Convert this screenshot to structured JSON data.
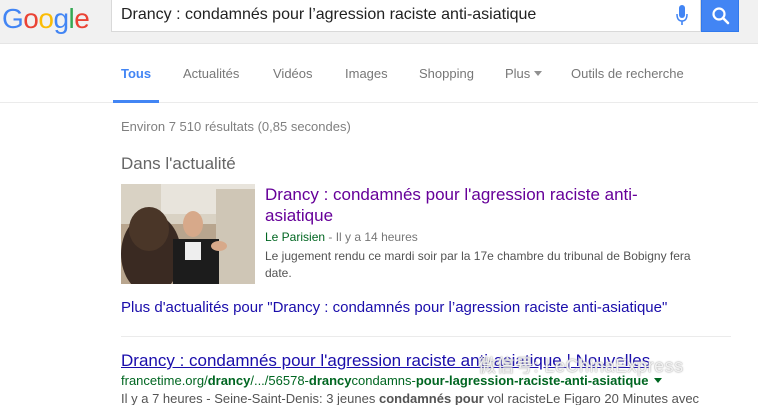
{
  "logo": {
    "letters": [
      {
        "char": "G",
        "color": "#4285f4"
      },
      {
        "char": "o",
        "color": "#ea4335"
      },
      {
        "char": "o",
        "color": "#fbbc05"
      },
      {
        "char": "g",
        "color": "#4285f4"
      },
      {
        "char": "l",
        "color": "#34a853"
      },
      {
        "char": "e",
        "color": "#ea4335"
      }
    ]
  },
  "search": {
    "value": "Drancy : condamnés pour l’agression raciste anti-asiatique"
  },
  "tabs": [
    {
      "label": "Tous",
      "active": true
    },
    {
      "label": "Actualités"
    },
    {
      "label": "Vidéos"
    },
    {
      "label": "Images"
    },
    {
      "label": "Shopping"
    },
    {
      "label": "Plus"
    },
    {
      "label": "Outils de recherche"
    }
  ],
  "stats": "Environ 7 510 résultats (0,85 secondes)",
  "news": {
    "heading": "Dans l'actualité",
    "title": "Drancy : condamnés pour l'agression raciste anti-asiatique",
    "source": "Le Parisien",
    "time": " - Il y a 14 heures",
    "snippet": "Le jugement rendu ce mardi soir par la 17e chambre du tribunal de Bobigny fera date.",
    "more": "Plus d'actualités pour \"Drancy : condamnés pour l’agression raciste anti-asiatique\""
  },
  "result": {
    "title": "Drancy : condamnés pour l'agression raciste anti-asiatique | Nouvelles",
    "url_prefix": "francetime.org/",
    "url_b1": "drancy",
    "url_mid": "/.../56578-",
    "url_b2": "drancy",
    "url_mid2": "condamns-",
    "url_b3": "pour-lagression-raciste-anti-asiatique",
    "snippet_time": "Il y a 7 heures",
    "snippet_a": " - Seine-Saint-Denis: 3 jeunes ",
    "snippet_b": "condamnés pour",
    "snippet_c": " vol racisteLe Figaro 20 Minutes avec"
  },
  "watermark": "微信号: LeChinaExpress",
  "colors": {
    "accent": "#4285f4",
    "visited": "#660099",
    "link": "#1a0dab",
    "url": "#006621"
  }
}
